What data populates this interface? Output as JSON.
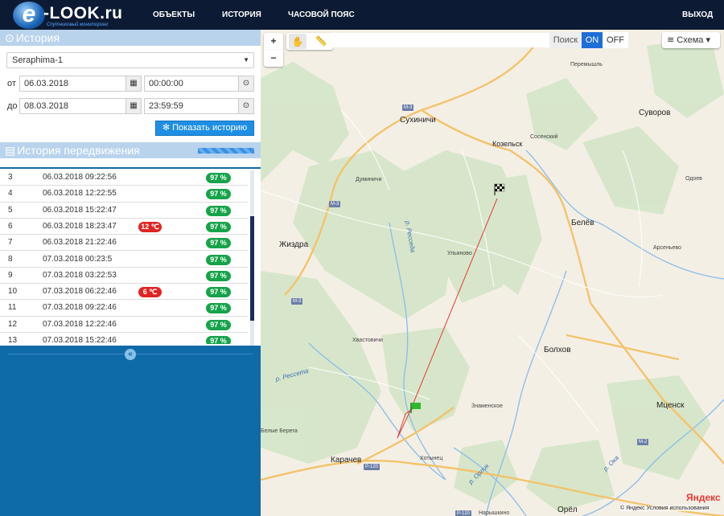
{
  "header": {
    "logo_text": "-LOOK.ru",
    "logo_letter": "e",
    "logo_sub": "Спутниковый мониторинг",
    "nav": [
      "ОБЪЕКТЫ",
      "ИСТОРИЯ",
      "ЧАСОВОЙ ПОЯС"
    ],
    "logout": "ВЫХОД"
  },
  "history_panel": {
    "title": "История",
    "object": "Seraphima-1",
    "from_label": "от",
    "to_label": "до",
    "from_date": "06.03.2018",
    "from_time": "00:00:00",
    "to_date": "08.03.2018",
    "to_time": "23:59:59",
    "show_button": "Показать историю"
  },
  "movement": {
    "title": "История передвижения",
    "rows": [
      {
        "n": "3",
        "time": "06.03.2018 09:22:56",
        "temp": "",
        "battery": "97 %"
      },
      {
        "n": "4",
        "time": "06.03.2018 12:22:55",
        "temp": "",
        "battery": "97 %"
      },
      {
        "n": "5",
        "time": "06.03.2018 15:22:47",
        "temp": "",
        "battery": "97 %"
      },
      {
        "n": "6",
        "time": "06.03.2018 18:23:47",
        "temp": "12 ℃",
        "battery": "97 %"
      },
      {
        "n": "7",
        "time": "06.03.2018 21:22:46",
        "temp": "",
        "battery": "97 %"
      },
      {
        "n": "8",
        "time": "07.03.2018 00:23:5",
        "temp": "",
        "battery": "97 %"
      },
      {
        "n": "9",
        "time": "07.03.2018 03:22:53",
        "temp": "",
        "battery": "97 %"
      },
      {
        "n": "10",
        "time": "07.03.2018 06:22:46",
        "temp": "6 ℃",
        "battery": "97 %"
      },
      {
        "n": "11",
        "time": "07.03.2018 09:22:46",
        "temp": "",
        "battery": "97 %"
      },
      {
        "n": "12",
        "time": "07.03.2018 12:22:46",
        "temp": "",
        "battery": "97 %"
      },
      {
        "n": "13",
        "time": "07.03.2018 15:22:46",
        "temp": "",
        "battery": "97 %"
      }
    ]
  },
  "map": {
    "zoom_in": "+",
    "zoom_out": "−",
    "search_label": "Поиск",
    "on_label": "ON",
    "off_label": "OFF",
    "layer_label": "Схема",
    "attribution": "© Яндекс  Условия использования",
    "brand": "Яндекс",
    "places": [
      {
        "name": "Перемышль",
        "cls": "small"
      },
      {
        "name": "Сухиничи",
        "cls": "big"
      },
      {
        "name": "Козельск",
        "cls": ""
      },
      {
        "name": "Сосенский",
        "cls": "small"
      },
      {
        "name": "Суворов",
        "cls": "big"
      },
      {
        "name": "Думиничи",
        "cls": "small"
      },
      {
        "name": "Одоев",
        "cls": "small"
      },
      {
        "name": "Белёв",
        "cls": "big"
      },
      {
        "name": "Жиздра",
        "cls": "big"
      },
      {
        "name": "Ульяново",
        "cls": "small"
      },
      {
        "name": "Арсеньево",
        "cls": "small"
      },
      {
        "name": "р. Ресседа",
        "cls": "river"
      },
      {
        "name": "Хвастовичи",
        "cls": "small"
      },
      {
        "name": "Болхов",
        "cls": "big"
      },
      {
        "name": "р. Рессета",
        "cls": "river"
      },
      {
        "name": "Знаменское",
        "cls": "small"
      },
      {
        "name": "Мценск",
        "cls": "big"
      },
      {
        "name": "Белые Берега",
        "cls": "small"
      },
      {
        "name": "Карачев",
        "cls": "big"
      },
      {
        "name": "Хотынец",
        "cls": "small"
      },
      {
        "name": "р. Орлик",
        "cls": "river"
      },
      {
        "name": "р. Ока",
        "cls": "river"
      },
      {
        "name": "Нарышкино",
        "cls": "small"
      },
      {
        "name": "Орёл",
        "cls": "big"
      }
    ],
    "roads": [
      "М-3",
      "М-3",
      "М-3",
      "М-2",
      "Р-120",
      "Р-120"
    ]
  },
  "colors": {
    "topbar": "#0c1b33",
    "panel_head": "#b9d3ec",
    "button": "#1e8fe4",
    "badge_green": "#16a34a",
    "badge_red": "#e02424",
    "track": "#e53935"
  }
}
